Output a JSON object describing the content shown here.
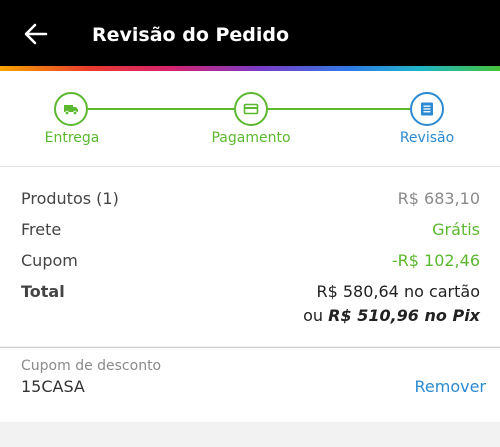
{
  "header": {
    "title": "Revisão do Pedido",
    "back_icon": "arrow-left-icon"
  },
  "colors": {
    "accent_green": "#5cb82f",
    "accent_blue": "#2b8ad1",
    "header_bg": "#000000"
  },
  "stepper": {
    "steps": [
      {
        "label": "Entrega",
        "icon": "truck-icon",
        "state": "done"
      },
      {
        "label": "Pagamento",
        "icon": "credit-card-icon",
        "state": "done"
      },
      {
        "label": "Revisão",
        "icon": "document-list-icon",
        "state": "current"
      }
    ]
  },
  "summary": {
    "products_label": "Produtos (1)",
    "products_value": "R$ 683,10",
    "shipping_label": "Frete",
    "shipping_value": "Grátis",
    "coupon_label": "Cupom",
    "coupon_value": "-R$ 102,46",
    "total_label": "Total",
    "total_card": "R$ 580,64 no cartão",
    "total_or": "ou",
    "total_pix": "R$ 510,96 no Pix"
  },
  "coupon": {
    "caption": "Cupom de desconto",
    "code": "15CASA",
    "remove_label": "Remover"
  }
}
